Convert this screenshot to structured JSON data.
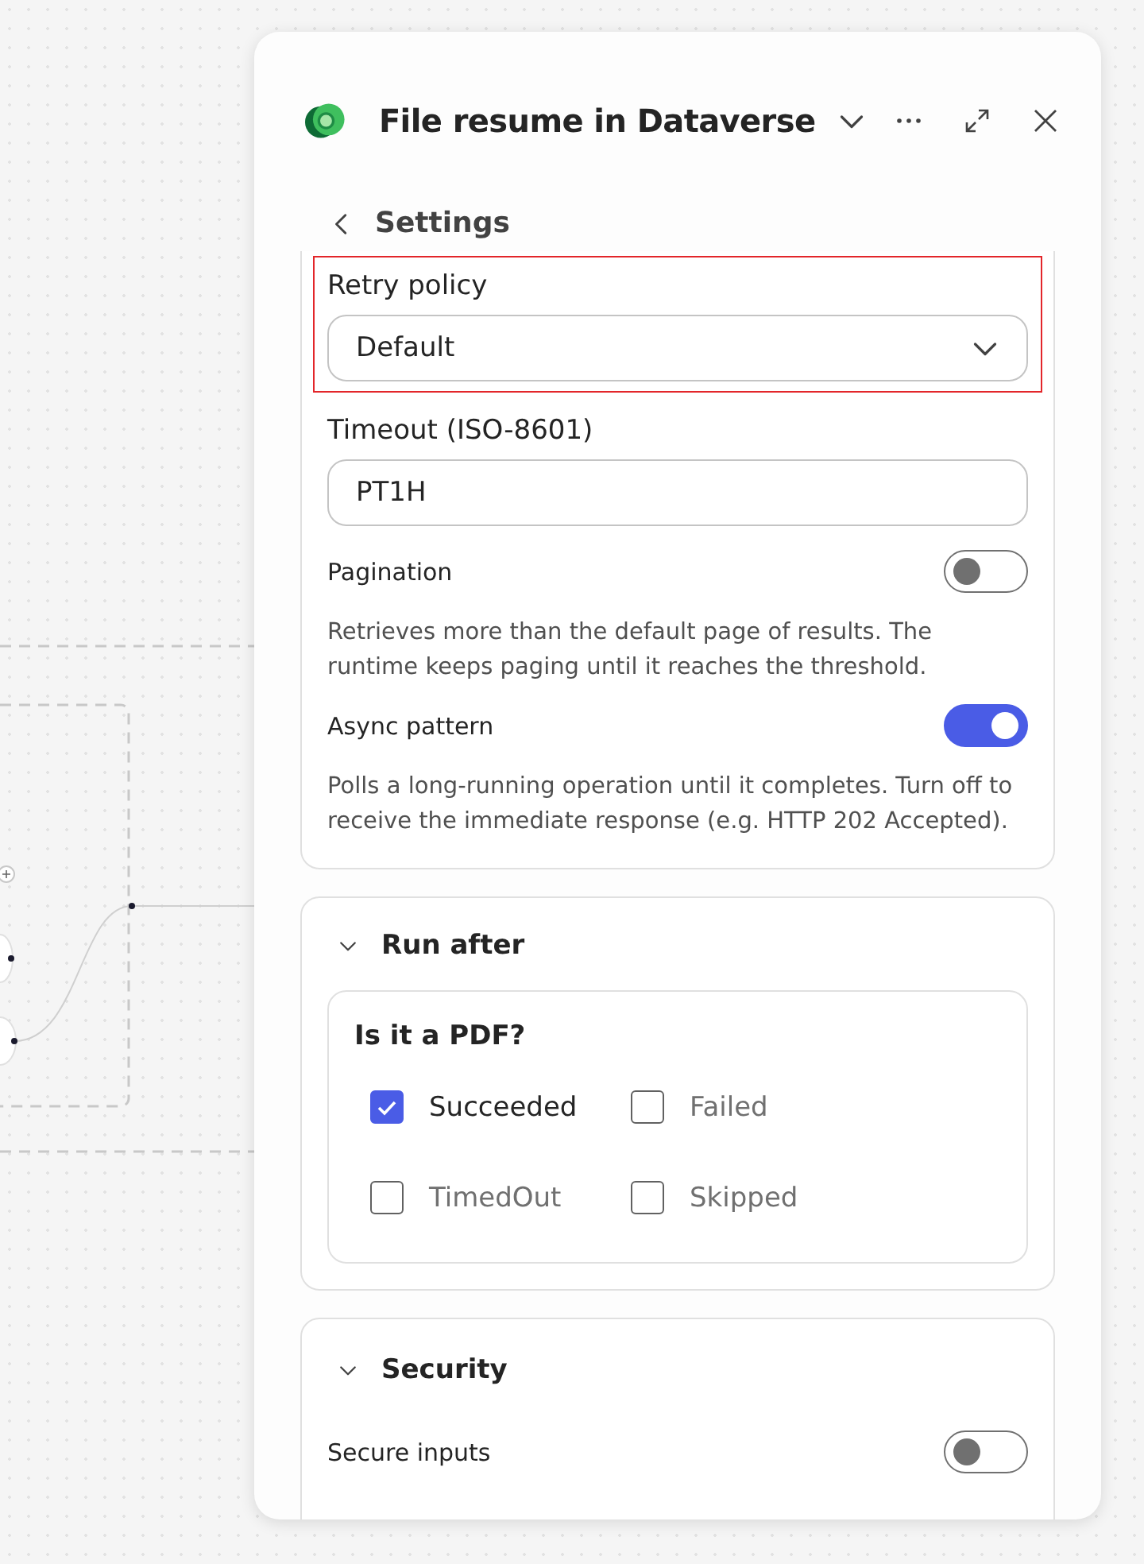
{
  "header": {
    "title": "File resume in Dataverse"
  },
  "back": {
    "label": "Settings"
  },
  "settings": {
    "retry_policy": {
      "label": "Retry policy",
      "value": "Default",
      "highlighted": true
    },
    "timeout": {
      "label": "Timeout (ISO-8601)",
      "value": "PT1H"
    },
    "toggles": [
      {
        "label": "Pagination",
        "on": false,
        "description": "Retrieves more than the default page of results. The runtime keeps paging until it reaches the threshold."
      },
      {
        "label": "Async pattern",
        "on": true,
        "description": "Polls a long-running operation until it completes. Turn off to receive the immediate response (e.g. HTTP 202 Accepted)."
      }
    ]
  },
  "run_after": {
    "title": "Run after",
    "expanded": true,
    "action": "Is it a PDF?",
    "options": [
      {
        "label": "Succeeded",
        "checked": true
      },
      {
        "label": "Failed",
        "checked": false
      },
      {
        "label": "TimedOut",
        "checked": false
      },
      {
        "label": "Skipped",
        "checked": false
      }
    ]
  },
  "security": {
    "title": "Security",
    "expanded": true,
    "toggles": [
      {
        "label": "Secure inputs",
        "on": false
      }
    ]
  }
}
